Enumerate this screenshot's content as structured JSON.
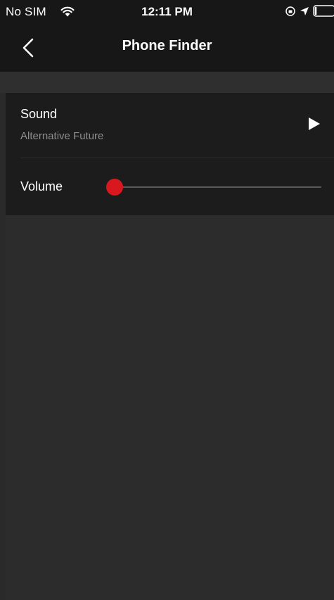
{
  "status_bar": {
    "carrier": "No SIM",
    "time": "12:11 PM",
    "icons": [
      "wifi-icon",
      "orientation-lock-icon",
      "location-arrow-icon",
      "battery-icon"
    ],
    "battery_level": 0.1
  },
  "nav": {
    "title": "Phone Finder",
    "back_icon": "chevron-left-icon"
  },
  "settings": {
    "sound": {
      "label": "Sound",
      "value": "Alternative Future",
      "action_icon": "play-icon"
    },
    "volume": {
      "label": "Volume",
      "level": 0.0
    }
  },
  "colors": {
    "accent": "#d8181e",
    "background": "#2a2a2a",
    "header": "#171717",
    "card": "#1c1c1c",
    "secondary_text": "#8e8e8e"
  }
}
